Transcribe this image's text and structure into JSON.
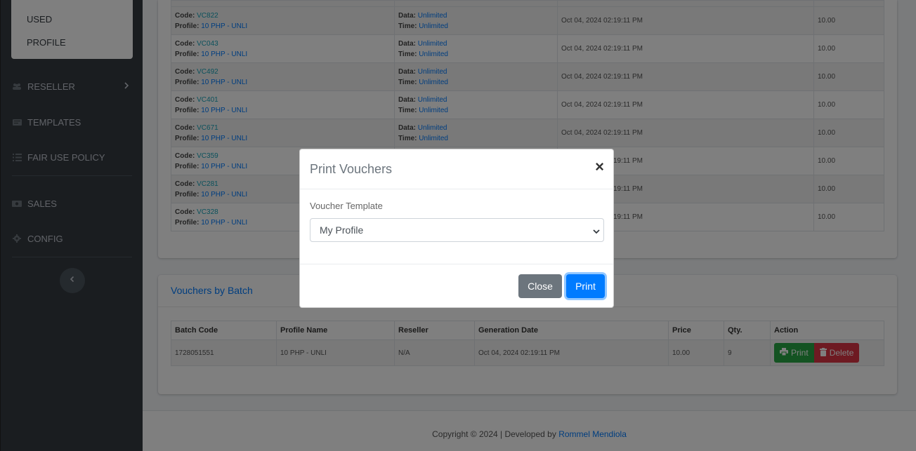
{
  "sidebar": {
    "submenu": [
      {
        "label": "USED"
      },
      {
        "label": "PROFILE"
      }
    ],
    "items": [
      {
        "label": "RESELLER",
        "icon": "users-icon"
      },
      {
        "label": "TEMPLATES",
        "icon": "template-icon"
      },
      {
        "label": "FAIR USE POLICY",
        "icon": "list-icon"
      },
      {
        "label": "SALES",
        "icon": "money-icon"
      },
      {
        "label": "CONFIG",
        "icon": "gear-icon"
      }
    ]
  },
  "vouchers": {
    "labels": {
      "code": "Code:",
      "profile": "Profile:",
      "data": "Data:",
      "time": "Time:"
    },
    "rows": [
      {
        "code": "VC822",
        "profile": "10 PHP - UNLI",
        "data": "Unlimited",
        "time": "Unlimited",
        "date": "Oct 04, 2024 02:19:11 PM",
        "price": "10.00"
      },
      {
        "code": "VC043",
        "profile": "10 PHP - UNLI",
        "data": "Unlimited",
        "time": "Unlimited",
        "date": "Oct 04, 2024 02:19:11 PM",
        "price": "10.00"
      },
      {
        "code": "VC492",
        "profile": "10 PHP - UNLI",
        "data": "Unlimited",
        "time": "Unlimited",
        "date": "Oct 04, 2024 02:19:11 PM",
        "price": "10.00"
      },
      {
        "code": "VC401",
        "profile": "10 PHP - UNLI",
        "data": "Unlimited",
        "time": "Unlimited",
        "date": "Oct 04, 2024 02:19:11 PM",
        "price": "10.00"
      },
      {
        "code": "VC671",
        "profile": "10 PHP - UNLI",
        "data": "Unlimited",
        "time": "Unlimited",
        "date": "Oct 04, 2024 02:19:11 PM",
        "price": "10.00"
      },
      {
        "code": "VC359",
        "profile": "10 PHP - UNLI",
        "data": "Unlimited",
        "time": "Unlimited",
        "date": "Oct 04, 2024 02:19:11 PM",
        "price": "10.00"
      },
      {
        "code": "VC281",
        "profile": "10 PHP - UNLI",
        "data": "Unlimited",
        "time": "Unlimited",
        "date": "Oct 04, 2024 02:19:11 PM",
        "price": "10.00"
      },
      {
        "code": "VC328",
        "profile": "10 PHP - UNLI",
        "data": "Unlimited",
        "time": "Unlimited",
        "date": "Oct 04, 2024 02:19:11 PM",
        "price": "10.00"
      }
    ]
  },
  "batch": {
    "title": "Vouchers by Batch",
    "headers": [
      "Batch Code",
      "Profile Name",
      "Reseller",
      "Generation Date",
      "Price",
      "Qty.",
      "Action"
    ],
    "rows": [
      {
        "batch_code": "1728051551",
        "profile": "10 PHP - UNLI",
        "reseller": "N/A",
        "date": "Oct 04, 2024 02:19:11 PM",
        "price": "10.00",
        "qty": "9"
      }
    ],
    "print_label": "Print",
    "delete_label": "Delete"
  },
  "footer": {
    "text": "Copyright © 2024 | Developed by",
    "author": "Rommel Mendiola"
  },
  "modal": {
    "title": "Print Vouchers",
    "close_glyph": "×",
    "field_label": "Voucher Template",
    "selected": "My Profile",
    "close_label": "Close",
    "print_label": "Print"
  },
  "colors": {
    "sidebar_bg": "#343a40",
    "primary": "#007bff",
    "success": "#28a745",
    "danger": "#dc3545",
    "secondary": "#6c757d"
  }
}
